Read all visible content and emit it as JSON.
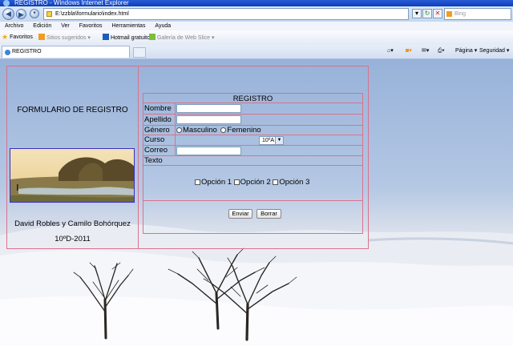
{
  "window": {
    "title": "REGISTRO - Windows Internet Explorer"
  },
  "address": {
    "url": "E:\\zzbla\\formulario\\index.html"
  },
  "search": {
    "placeholder": "Bing"
  },
  "menu": {
    "items": [
      "Archivo",
      "Edición",
      "Ver",
      "Favoritos",
      "Herramientas",
      "Ayuda"
    ]
  },
  "favorites": {
    "label": "Favoritos",
    "items": [
      "Sitios sugeridos ▾",
      "Hotmail gratuito",
      "Galería de Web Slice ▾"
    ]
  },
  "tabs": [
    {
      "label": "REGISTRO"
    }
  ],
  "commandbar": {
    "page": "Página ▾",
    "safety": "Seguridad ▾"
  },
  "page": {
    "left_title": "FORMULARIO DE REGISTRO",
    "authors": "David Robles y Camilo Bohórquez",
    "date": "10ºD-2011"
  },
  "form": {
    "title": "REGISTRO",
    "nombre_label": "Nombre",
    "apellido_label": "Apellido",
    "genero_label": "Género",
    "masculino": "Masculino",
    "femenino": "Femenino",
    "curso_label": "Curso",
    "curso_value": "10ºA",
    "correo_label": "Correo",
    "texto_label": "Texto",
    "opcion1": "Opción 1",
    "opcion2": "Opción 2",
    "opcion3": "Opción 3",
    "enviar": "Enviar",
    "borrar": "Borrar"
  },
  "colors": {
    "border": "#d9728c",
    "titlebar": "#0a3fb8"
  }
}
